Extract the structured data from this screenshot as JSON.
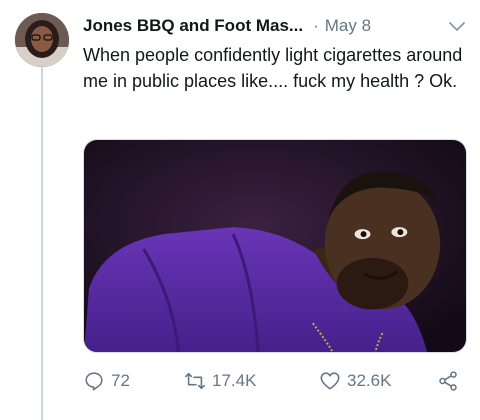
{
  "tweet": {
    "author_name": "Jones BBQ and Foot Mas...",
    "separator": "·",
    "date": "May 8",
    "text": "When people confidently light cigarettes around me in public places like.... fuck my health ? Ok.",
    "avatar": "avatar",
    "menu_icon": "chevron-down-icon",
    "media": "photo-man-purple-shirt"
  },
  "actions": {
    "reply_count": "72",
    "retweet_count": "17.4K",
    "like_count": "32.6K"
  },
  "colors": {
    "text": "#14171a",
    "muted": "#657786",
    "thread_line": "#ccd6dd",
    "shirt": "#5a2b9c"
  }
}
